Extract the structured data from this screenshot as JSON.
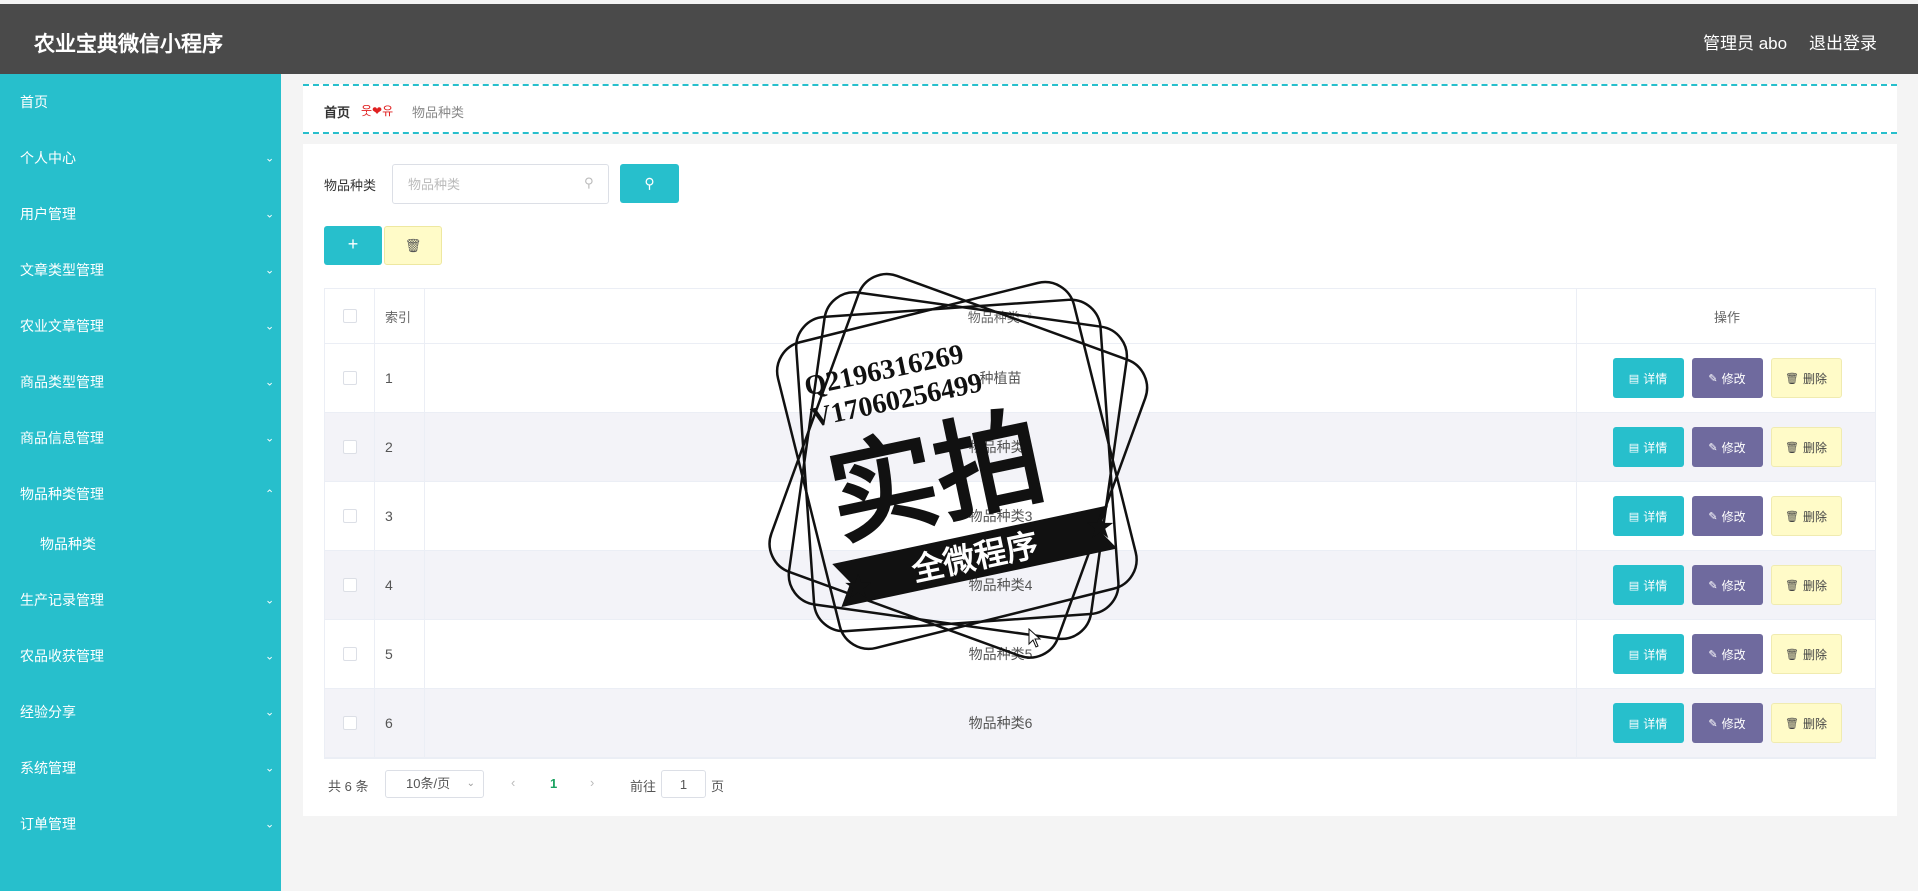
{
  "header": {
    "title": "农业宝典微信小程序",
    "admin": "管理员 abo",
    "logout": "退出登录"
  },
  "sidebar": {
    "items": [
      {
        "label": "首页",
        "has_children": false
      },
      {
        "label": "个人中心",
        "chevron": "chevron-down-icon"
      },
      {
        "label": "用户管理",
        "chevron": "chevron-down-icon"
      },
      {
        "label": "文章类型管理",
        "chevron": "chevron-down-icon"
      },
      {
        "label": "农业文章管理",
        "chevron": "chevron-down-icon"
      },
      {
        "label": "商品类型管理",
        "chevron": "chevron-down-icon"
      },
      {
        "label": "商品信息管理",
        "chevron": "chevron-down-icon"
      },
      {
        "label": "物品种类管理",
        "chevron": "chevron-up-icon",
        "expanded": true
      },
      {
        "label": "物品种类",
        "sub": true
      },
      {
        "label": "生产记录管理",
        "chevron": "chevron-down-icon"
      },
      {
        "label": "农品收获管理",
        "chevron": "chevron-down-icon"
      },
      {
        "label": "经验分享",
        "chevron": "chevron-down-icon"
      },
      {
        "label": "系统管理",
        "chevron": "chevron-down-icon"
      },
      {
        "label": "订单管理",
        "chevron": "chevron-down-icon"
      }
    ]
  },
  "breadcrumb": {
    "home": "首页",
    "separator": "웃❤유",
    "current": "物品种类"
  },
  "search": {
    "label": "物品种类",
    "placeholder": "物品种类"
  },
  "table": {
    "headers": {
      "index": "索引",
      "type": "物品种类",
      "ops": "操作"
    },
    "rows": [
      {
        "index": "1",
        "type": "种植苗"
      },
      {
        "index": "2",
        "type": "物品种类2"
      },
      {
        "index": "3",
        "type": "物品种类3"
      },
      {
        "index": "4",
        "type": "物品种类4"
      },
      {
        "index": "5",
        "type": "物品种类5"
      },
      {
        "index": "6",
        "type": "物品种类6"
      }
    ],
    "ops": {
      "detail": "详情",
      "edit": "修改",
      "delete": "删除"
    }
  },
  "pagination": {
    "total": "共 6 条",
    "page_size": "10条/页",
    "current": "1",
    "goto_prefix": "前往",
    "goto_value": "1",
    "goto_suffix": "页"
  },
  "watermark": {
    "line1": "Q2196316269",
    "line2": "V17060256499",
    "big": "实拍",
    "banner": "全微程序"
  },
  "colors": {
    "accent": "#27bfcc",
    "header": "#4a4a4a",
    "edit": "#6f6a9e",
    "delete_bg": "#fffbc8"
  }
}
